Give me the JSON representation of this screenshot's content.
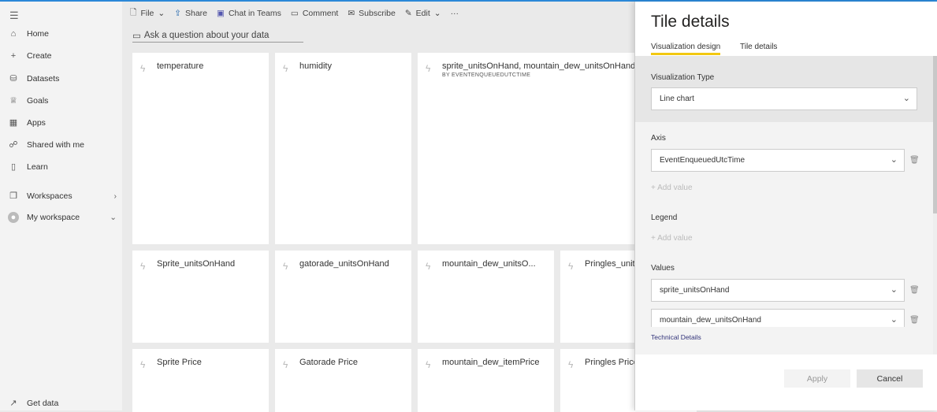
{
  "sidebar": {
    "items": [
      {
        "label": "Home",
        "icon": "home-icon"
      },
      {
        "label": "Create",
        "icon": "plus-icon"
      },
      {
        "label": "Datasets",
        "icon": "database-icon"
      },
      {
        "label": "Goals",
        "icon": "trophy-icon"
      },
      {
        "label": "Apps",
        "icon": "apps-icon"
      },
      {
        "label": "Shared with me",
        "icon": "shared-icon"
      },
      {
        "label": "Learn",
        "icon": "book-icon"
      },
      {
        "label": "Workspaces",
        "icon": "workspaces-icon"
      },
      {
        "label": "My workspace",
        "icon": "avatar-icon"
      }
    ],
    "get_data": "Get data"
  },
  "toolbar": {
    "file": "File",
    "share": "Share",
    "teams": "Chat in Teams",
    "comment": "Comment",
    "subscribe": "Subscribe",
    "edit": "Edit",
    "more": "···"
  },
  "qa": {
    "placeholder": "Ask a question about your data"
  },
  "tiles": [
    {
      "title": "temperature"
    },
    {
      "title": "humidity"
    },
    {
      "title": "sprite_unitsOnHand, mountain_dew_unitsOnHand, Pr",
      "subtitle": "BY EVENTENQUEUEDUTCTIME"
    },
    {
      "title": "Sprite_unitsOnHand"
    },
    {
      "title": "gatorade_unitsOnHand"
    },
    {
      "title": "mountain_dew_unitsO..."
    },
    {
      "title": "Pringles_units"
    },
    {
      "title": "Sprite Price"
    },
    {
      "title": "Gatorade Price"
    },
    {
      "title": "mountain_dew_itemPrice"
    },
    {
      "title": "Pringles Price"
    }
  ],
  "panel": {
    "title": "Tile details",
    "tabs": [
      "Visualization design",
      "Tile details"
    ],
    "viz_type_label": "Visualization Type",
    "viz_type": "Line chart",
    "axis_label": "Axis",
    "axis_value": "EventEnqueuedUtcTime",
    "add_value": "Add value",
    "legend_label": "Legend",
    "values_label": "Values",
    "values": [
      "sprite_unitsOnHand",
      "mountain_dew_unitsOnHand"
    ],
    "technical_details": "Technical Details",
    "apply": "Apply",
    "cancel": "Cancel"
  }
}
